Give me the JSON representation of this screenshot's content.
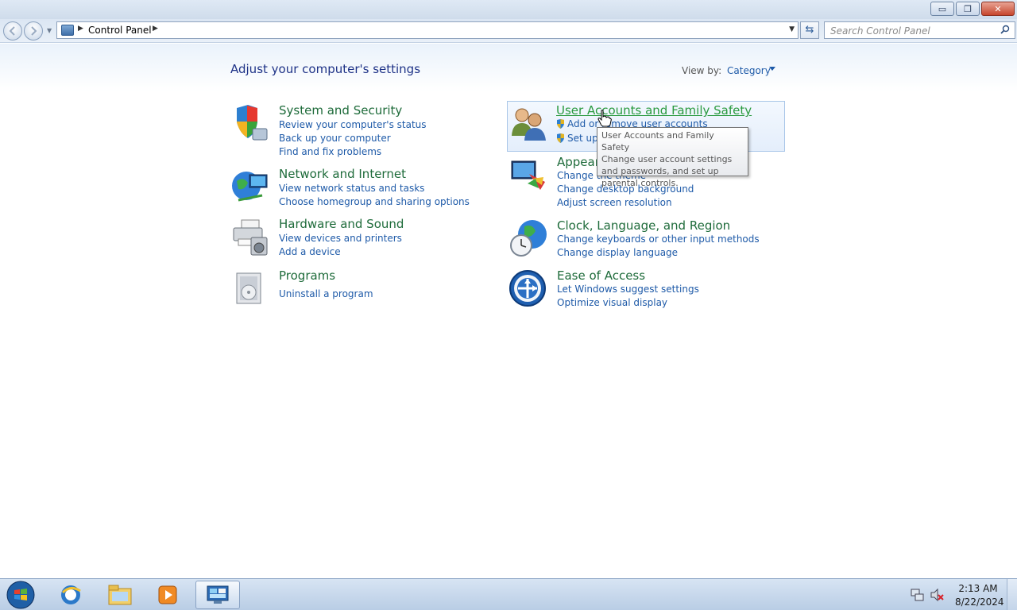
{
  "window": {
    "minimize_glyph": "▭",
    "restore_glyph": "❐",
    "close_glyph": "✕"
  },
  "navbar": {
    "breadcrumb": "Control Panel",
    "search_placeholder": "Search Control Panel"
  },
  "page": {
    "heading": "Adjust your computer's settings",
    "view_by_label": "View by:",
    "view_by_value": "Category"
  },
  "categories": {
    "system_security": {
      "title": "System and Security",
      "links": [
        "Review your computer's status",
        "Back up your computer",
        "Find and fix problems"
      ]
    },
    "network_internet": {
      "title": "Network and Internet",
      "links": [
        "View network status and tasks",
        "Choose homegroup and sharing options"
      ]
    },
    "hardware_sound": {
      "title": "Hardware and Sound",
      "links": [
        "View devices and printers",
        "Add a device"
      ]
    },
    "programs": {
      "title": "Programs",
      "links": [
        "Uninstall a program"
      ]
    },
    "user_accounts": {
      "title": "User Accounts and Family Safety",
      "links": [
        "Add or remove user accounts",
        "Set up parental controls for any user"
      ]
    },
    "appearance": {
      "title": "Appearance and Personalization",
      "links": [
        "Change the theme",
        "Change desktop background",
        "Adjust screen resolution"
      ]
    },
    "clock_region": {
      "title": "Clock, Language, and Region",
      "links": [
        "Change keyboards or other input methods",
        "Change display language"
      ]
    },
    "ease_access": {
      "title": "Ease of Access",
      "links": [
        "Let Windows suggest settings",
        "Optimize visual display"
      ]
    }
  },
  "tooltip": {
    "title": "User Accounts and Family Safety",
    "body": "Change user account settings and passwords, and set up parental controls."
  },
  "taskbar": {
    "time": "2:13 AM",
    "date": "8/22/2024"
  },
  "colors": {
    "category_title": "#1e6b3a",
    "link": "#1e5aa8",
    "heading": "#1e3287"
  }
}
